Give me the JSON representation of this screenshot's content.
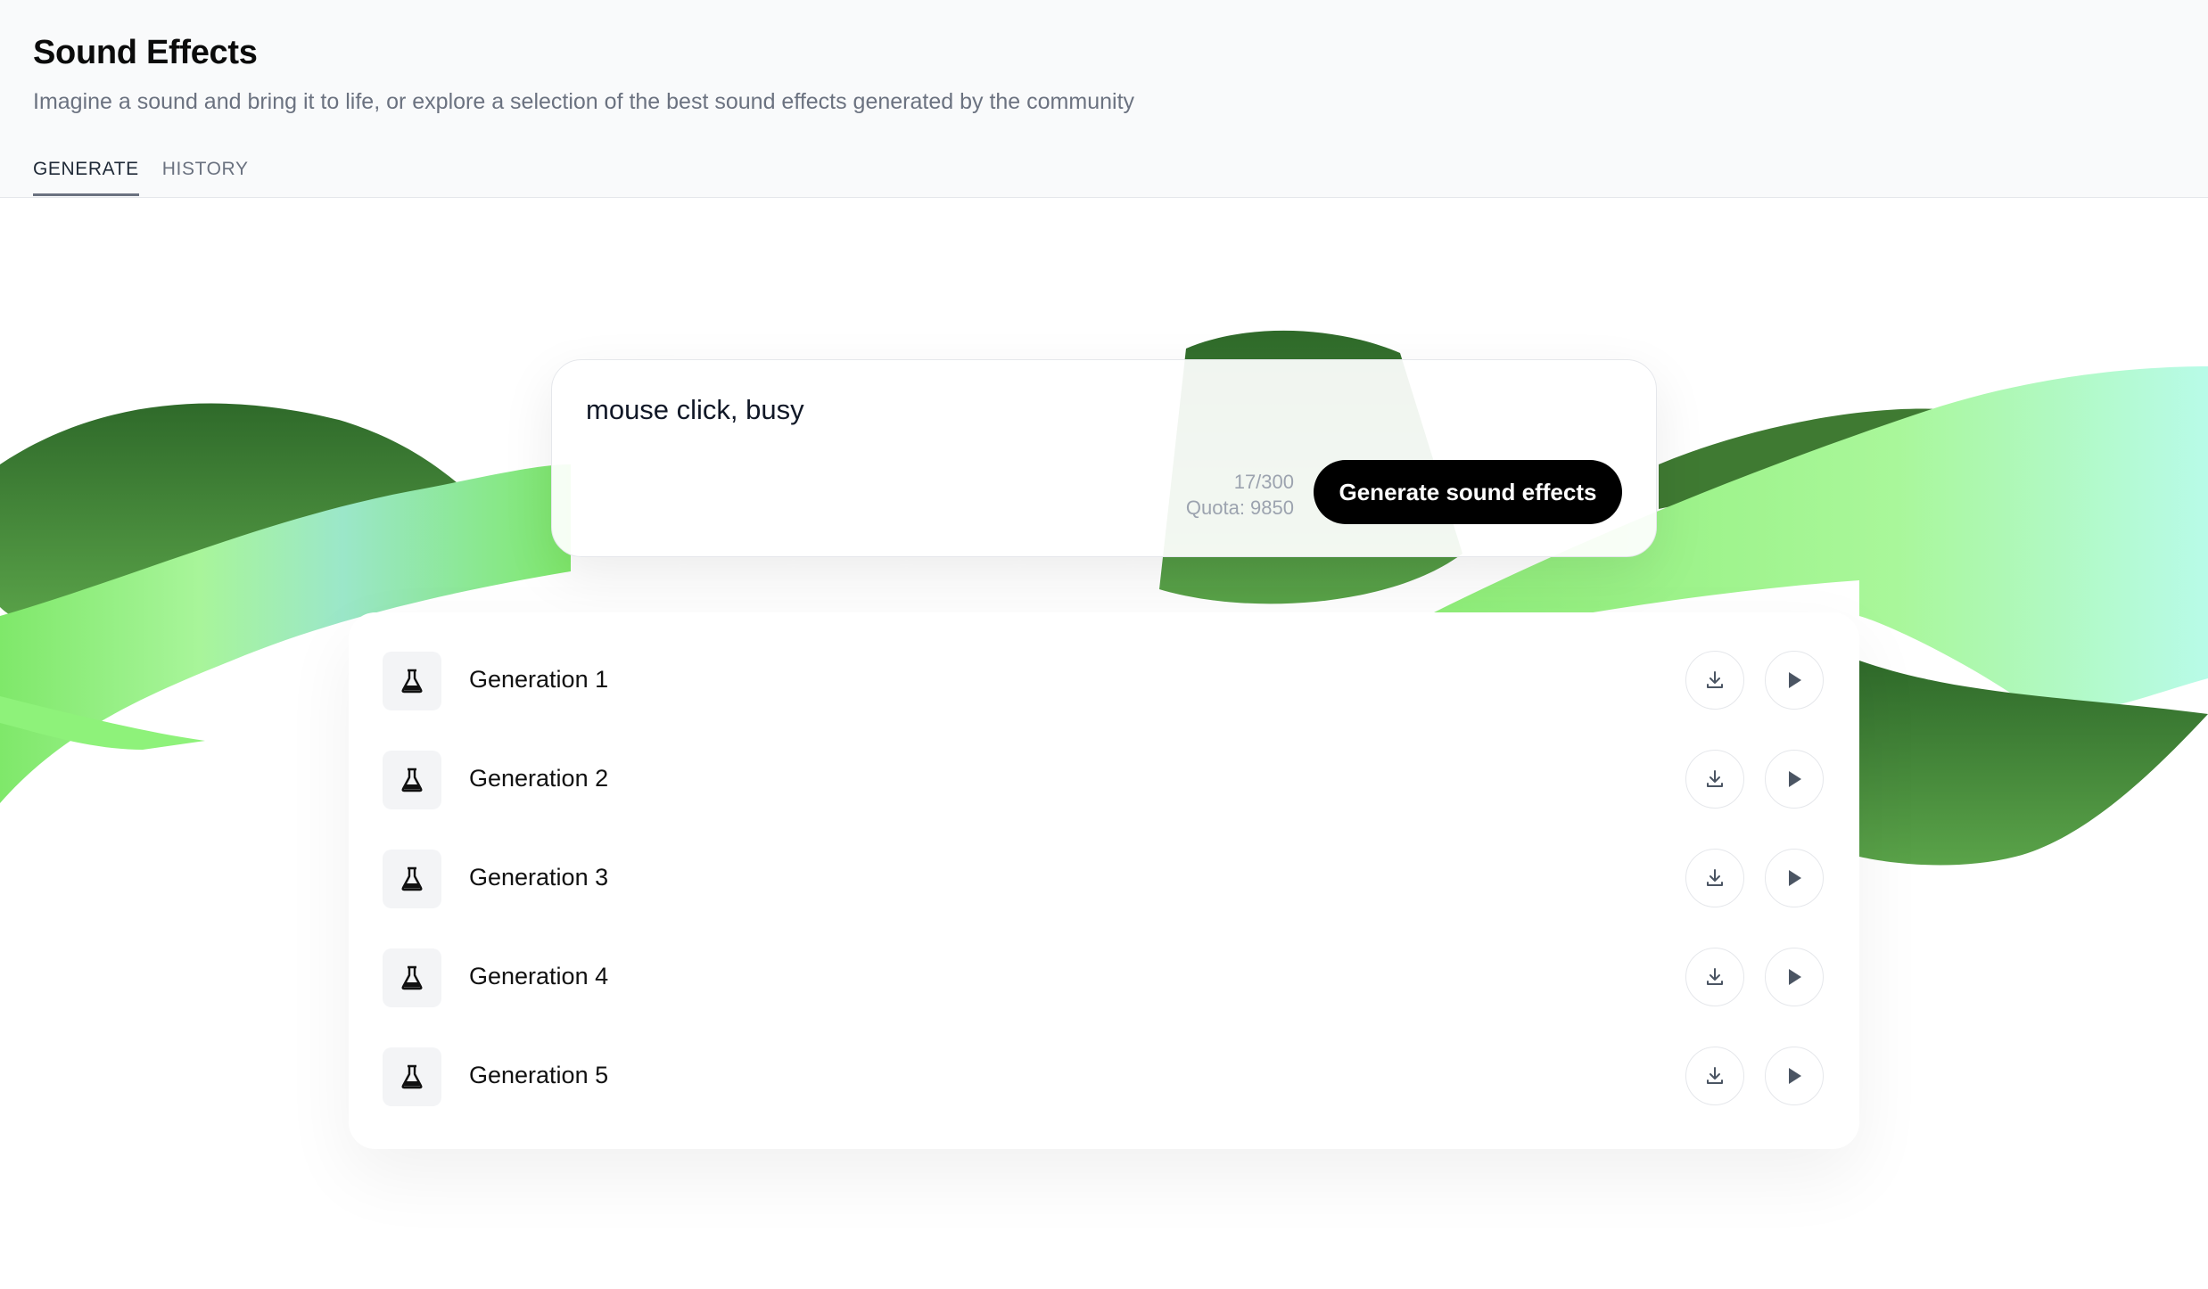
{
  "header": {
    "title": "Sound Effects",
    "subtitle": "Imagine a sound and bring it to life, or explore a selection of the best sound effects generated by the community",
    "tabs": [
      {
        "label": "GENERATE",
        "active": true
      },
      {
        "label": "HISTORY",
        "active": false
      }
    ]
  },
  "prompt": {
    "text": "mouse click, busy",
    "char_count": "17/300",
    "quota": "Quota: 9850",
    "button_label": "Generate sound effects"
  },
  "results": {
    "items": [
      {
        "label": "Generation 1",
        "icon": "flask-icon"
      },
      {
        "label": "Generation 2",
        "icon": "flask-icon"
      },
      {
        "label": "Generation 3",
        "icon": "flask-icon"
      },
      {
        "label": "Generation 4",
        "icon": "flask-icon"
      },
      {
        "label": "Generation 5",
        "icon": "flask-icon"
      }
    ],
    "row_actions": [
      "download-icon",
      "play-icon"
    ]
  },
  "colors": {
    "accent_button": "#000000",
    "wave_dark_green": "#3f7a32",
    "wave_light_green": "#8ef27a",
    "wave_mint": "#9ff5e4"
  }
}
